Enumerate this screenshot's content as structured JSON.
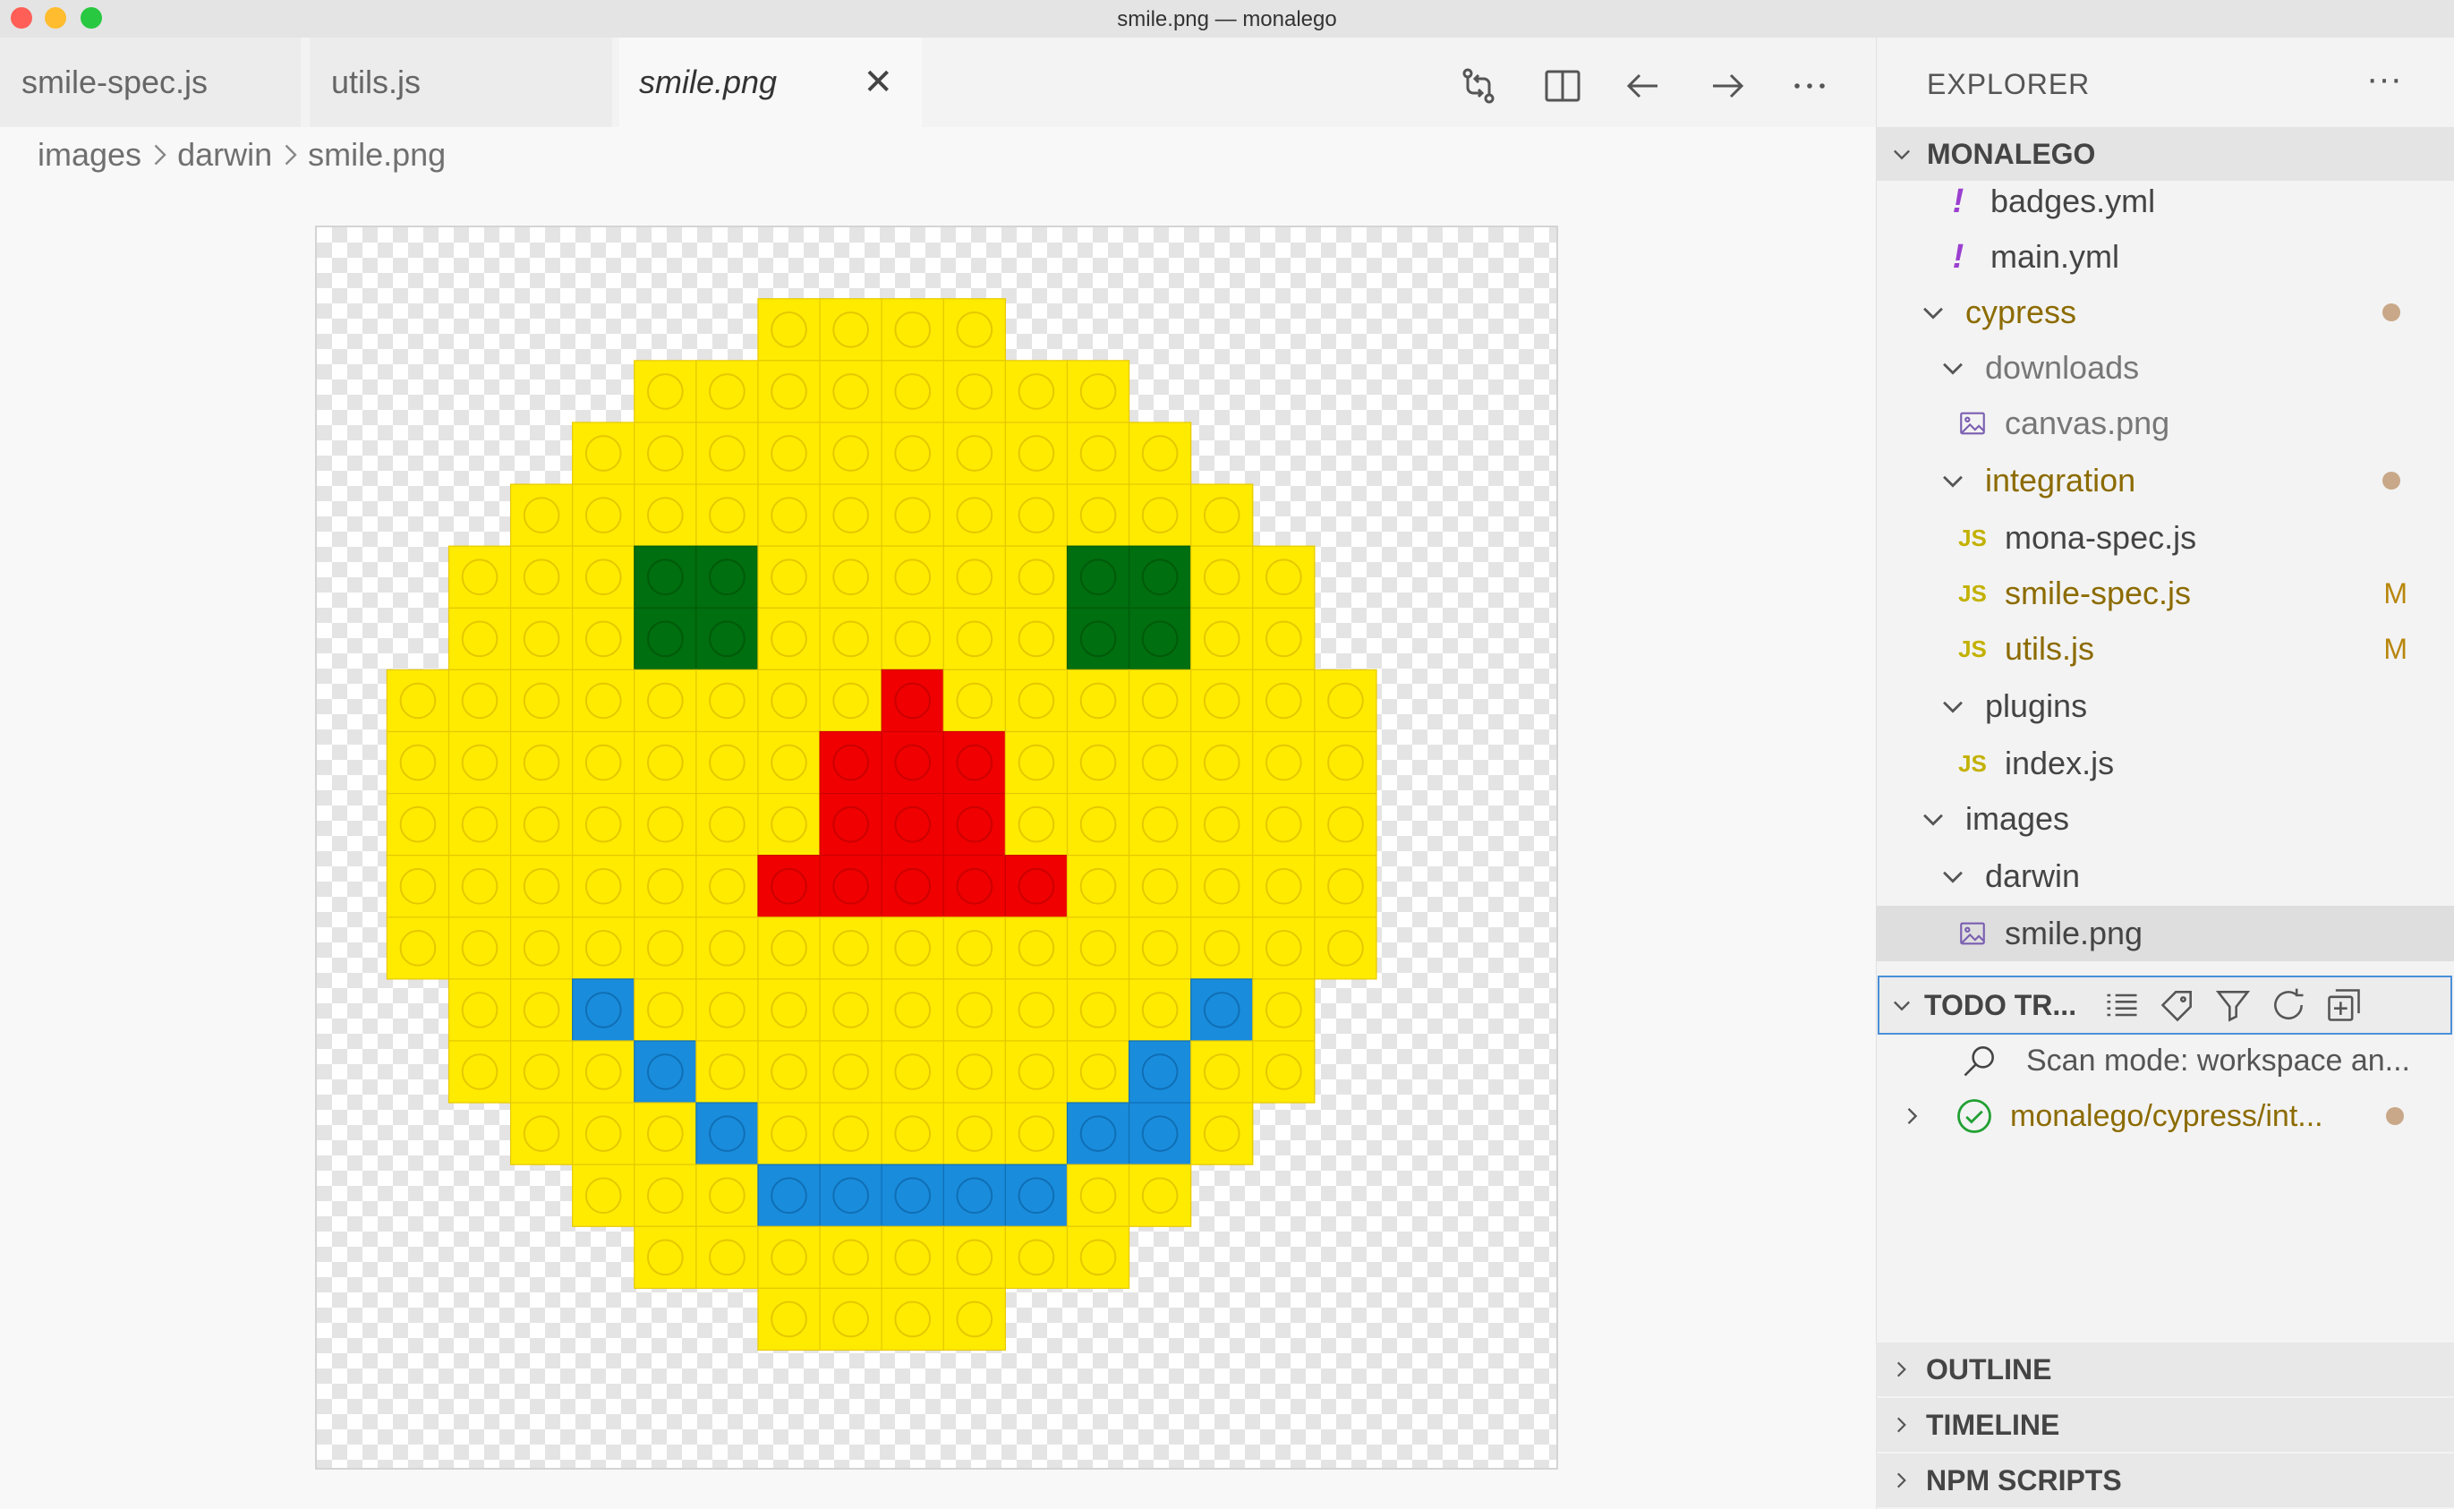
{
  "window": {
    "title": "smile.png — monalego",
    "traffic_lights": {
      "close": "#ff5f57",
      "minimize": "#febc2e",
      "zoom": "#28c840"
    }
  },
  "tabs": [
    {
      "label": "smile-spec.js"
    },
    {
      "label": "utils.js"
    },
    {
      "label": "smile.png",
      "active": true,
      "close_icon": "close-icon"
    }
  ],
  "toolbar": {
    "icons": [
      "git-compare-icon",
      "split-editor-icon",
      "arrow-left-icon",
      "arrow-right-icon",
      "more-icon"
    ]
  },
  "breadcrumb": [
    "images",
    "darwin",
    "smile.png"
  ],
  "image_colors": {
    "yellow": "#ffeb00",
    "green": "#006f0f",
    "red": "#f00000",
    "blue": "#1a8cdc"
  },
  "explorer": {
    "header": "EXPLORER",
    "more_label": "···",
    "root": "MONALEGO",
    "items": [
      {
        "label": "badges.yml",
        "icon": "yaml-icon"
      },
      {
        "label": "main.yml",
        "icon": "yaml-icon"
      },
      {
        "label": "cypress",
        "icon": "chevron-down-icon",
        "status": "dot"
      },
      {
        "label": "downloads",
        "icon": "chevron-down-icon"
      },
      {
        "label": "canvas.png",
        "icon": "image-file-icon"
      },
      {
        "label": "integration",
        "icon": "chevron-down-icon",
        "status": "dot"
      },
      {
        "label": "mona-spec.js",
        "icon": "js-file-icon"
      },
      {
        "label": "smile-spec.js",
        "icon": "js-file-icon",
        "badge": "M"
      },
      {
        "label": "utils.js",
        "icon": "js-file-icon",
        "badge": "M"
      },
      {
        "label": "plugins",
        "icon": "chevron-down-icon"
      },
      {
        "label": "index.js",
        "icon": "js-file-icon"
      },
      {
        "label": "images",
        "icon": "chevron-down-icon"
      },
      {
        "label": "darwin",
        "icon": "chevron-down-icon"
      },
      {
        "label": "smile.png",
        "icon": "image-file-icon",
        "selected": true
      }
    ],
    "js_label": "JS",
    "yml_label": "!"
  },
  "todo": {
    "header": "TODO TR...",
    "tools": [
      "list-icon",
      "tag-icon",
      "filter-icon",
      "refresh-icon",
      "collapse-all-icon"
    ],
    "scan_mode": "Scan mode: workspace an...",
    "tree_item": "monalego/cypress/int..."
  },
  "bottom_sections": [
    "OUTLINE",
    "TIMELINE",
    "NPM SCRIPTS"
  ]
}
